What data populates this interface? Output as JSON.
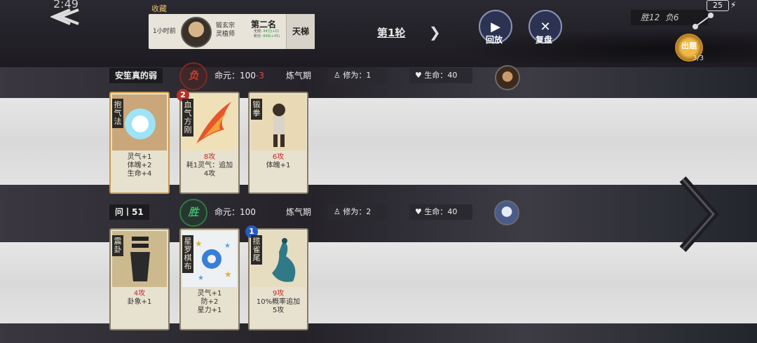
{
  "status": {
    "time": "2:49",
    "battery": "25"
  },
  "record": {
    "label": "收藏",
    "ago": "1小时前",
    "sect": "锻玄宗",
    "title": "灵植师",
    "rank": "第二名",
    "stats": [
      "无限:",
      "44分(+0)",
      "积分:",
      "849(+45)"
    ],
    "ladder": "天梯"
  },
  "round": {
    "label": "第1轮"
  },
  "buttons": {
    "replay": "回放",
    "review": "复盘"
  },
  "score": {
    "wins": "胜12",
    "losses": "负6"
  },
  "tournament": {
    "label": "出题",
    "count": "3/3"
  },
  "players": [
    {
      "name": "安笙真的弱",
      "result": "负",
      "life_label": "命元：100",
      "life_delta": "-3",
      "realm": "炼气期",
      "cultivation": "修为：1",
      "hp": "生命：40"
    },
    {
      "name": "问丨51",
      "result": "胜",
      "life_label": "命元：100",
      "life_delta": "",
      "realm": "炼气期",
      "cultivation": "修为：2",
      "hp": "生命：40"
    }
  ],
  "cards": [
    {
      "name": "抱气法",
      "lines": [
        "灵气+1",
        "体魄+2",
        "生命+4"
      ],
      "badge": ""
    },
    {
      "name": "血气方刚",
      "lines": [
        "8攻",
        "耗1灵气：追加",
        "4攻"
      ],
      "badge": "2"
    },
    {
      "name": "锻拳",
      "lines": [
        "6攻",
        "体魄+1"
      ],
      "badge": ""
    },
    {
      "name": "震卦",
      "lines": [
        "4攻",
        "卦象+1"
      ],
      "badge": ""
    },
    {
      "name": "星罗棋布",
      "lines": [
        "灵气+1",
        "防+2",
        "星力+1"
      ],
      "badge": ""
    },
    {
      "name": "揽雀尾",
      "lines": [
        "9攻",
        "10%概率追加",
        "5攻"
      ],
      "badge": "1"
    }
  ],
  "colors": {
    "lose": "#c93a2e",
    "win": "#3fb36b",
    "attack": "#c42b2b",
    "qi": "#2a6bd4",
    "defense": "#c28a18"
  }
}
